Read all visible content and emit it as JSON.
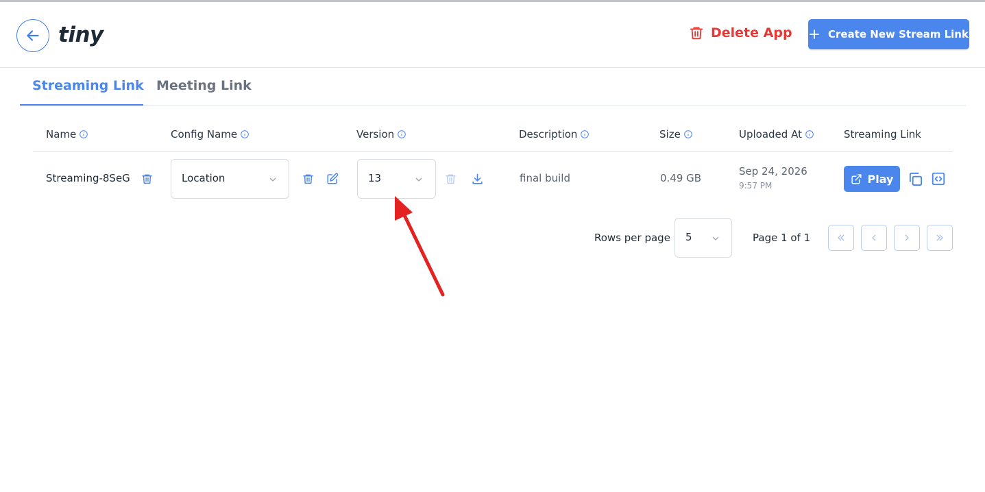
{
  "app": {
    "logo": "tiny"
  },
  "header": {
    "delete_label": "Delete App",
    "create_label": "Create New Stream Link"
  },
  "tabs": [
    {
      "label": "Streaming Link",
      "active": true
    },
    {
      "label": "Meeting Link",
      "active": false
    }
  ],
  "table": {
    "columns": [
      "Name",
      "Config Name",
      "Version",
      "Description",
      "Size",
      "Uploaded At",
      "Streaming Link"
    ],
    "rows": [
      {
        "name": "Streaming-8SeG",
        "config": "Location",
        "version": "13",
        "description": "final build",
        "size": "0.49 GB",
        "uploaded_date": "Sep 24, 2026",
        "uploaded_time": "9:57 PM",
        "play_label": "Play"
      }
    ]
  },
  "pagination": {
    "rows_label": "Rows per page",
    "rows_value": "5",
    "page_label": "Page 1 of 1"
  },
  "colors": {
    "accent": "#4a86ec",
    "danger": "#e53935",
    "annotation": "#e32222"
  },
  "icons": [
    "back-arrow-icon",
    "trash-icon",
    "plus-icon",
    "info-icon",
    "edit-icon",
    "download-icon",
    "external-link-icon",
    "copy-icon",
    "code-icon",
    "chevron-down-icon",
    "double-chevron-left-icon",
    "chevron-left-icon",
    "chevron-right-icon",
    "double-chevron-right-icon"
  ]
}
